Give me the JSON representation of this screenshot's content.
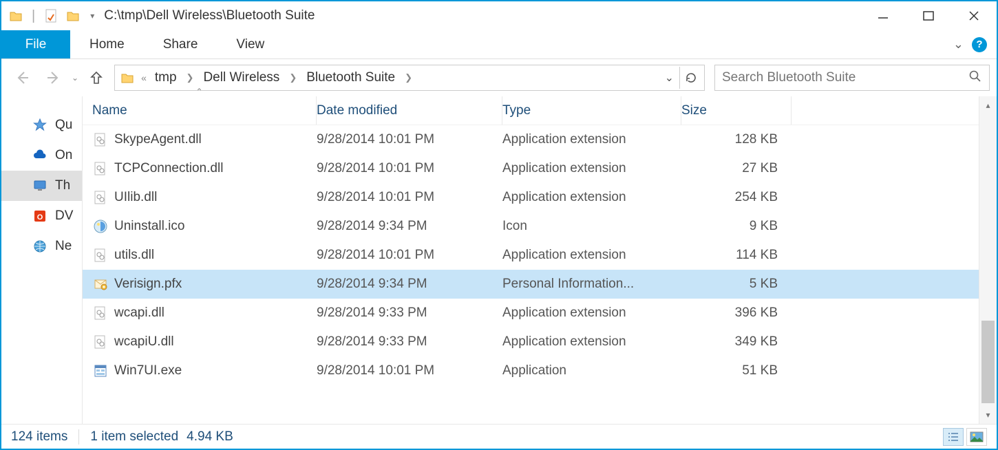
{
  "title_path": "C:\\tmp\\Dell Wireless\\Bluetooth Suite",
  "ribbon": {
    "file": "File",
    "home": "Home",
    "share": "Share",
    "view": "View"
  },
  "breadcrumb": {
    "ellipsis": "«",
    "segs": [
      "tmp",
      "Dell Wireless",
      "Bluetooth Suite"
    ]
  },
  "search": {
    "placeholder": "Search Bluetooth Suite"
  },
  "sidebar": {
    "items": [
      {
        "label": "Quick access",
        "short": "Qu",
        "icon": "star",
        "selected": false
      },
      {
        "label": "OneDrive",
        "short": "On",
        "icon": "cloud",
        "selected": false
      },
      {
        "label": "This PC",
        "short": "Th",
        "icon": "pc",
        "selected": true
      },
      {
        "label": "DVD Drive",
        "short": "DV",
        "icon": "office",
        "selected": false
      },
      {
        "label": "Network",
        "short": "Ne",
        "icon": "globe",
        "selected": false
      }
    ]
  },
  "columns": {
    "name": "Name",
    "date": "Date modified",
    "type": "Type",
    "size": "Size"
  },
  "files": [
    {
      "name": "SkypeAgent.dll",
      "date": "9/28/2014 10:01 PM",
      "type": "Application extension",
      "size": "128 KB",
      "icon": "dll",
      "selected": false
    },
    {
      "name": "TCPConnection.dll",
      "date": "9/28/2014 10:01 PM",
      "type": "Application extension",
      "size": "27 KB",
      "icon": "dll",
      "selected": false
    },
    {
      "name": "UIlib.dll",
      "date": "9/28/2014 10:01 PM",
      "type": "Application extension",
      "size": "254 KB",
      "icon": "dll",
      "selected": false
    },
    {
      "name": "Uninstall.ico",
      "date": "9/28/2014 9:34 PM",
      "type": "Icon",
      "size": "9 KB",
      "icon": "ico",
      "selected": false
    },
    {
      "name": "utils.dll",
      "date": "9/28/2014 10:01 PM",
      "type": "Application extension",
      "size": "114 KB",
      "icon": "dll",
      "selected": false
    },
    {
      "name": "Verisign.pfx",
      "date": "9/28/2014 9:34 PM",
      "type": "Personal Information...",
      "size": "5 KB",
      "icon": "pfx",
      "selected": true
    },
    {
      "name": "wcapi.dll",
      "date": "9/28/2014 9:33 PM",
      "type": "Application extension",
      "size": "396 KB",
      "icon": "dll",
      "selected": false
    },
    {
      "name": "wcapiU.dll",
      "date": "9/28/2014 9:33 PM",
      "type": "Application extension",
      "size": "349 KB",
      "icon": "dll",
      "selected": false
    },
    {
      "name": "Win7UI.exe",
      "date": "9/28/2014 10:01 PM",
      "type": "Application",
      "size": "51 KB",
      "icon": "exe",
      "selected": false
    }
  ],
  "status": {
    "items": "124 items",
    "selected": "1 item selected",
    "size": "4.94 KB"
  }
}
